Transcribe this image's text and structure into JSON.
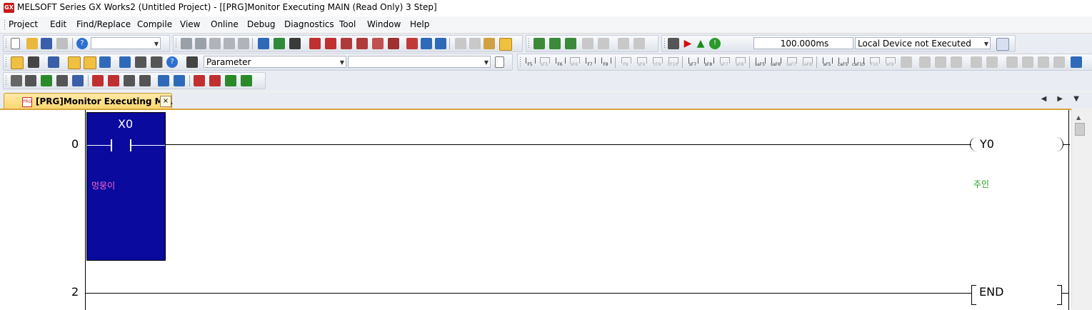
{
  "app": {
    "icon_label": "GX",
    "title": "MELSOFT Series GX Works2 (Untitled Project) - [[PRG]Monitor Executing MAIN (Read Only) 3 Step]"
  },
  "menu": [
    "Project",
    "Edit",
    "Find/Replace",
    "Compile",
    "View",
    "Online",
    "Debug",
    "Diagnostics",
    "Tool",
    "Window",
    "Help"
  ],
  "toolbar": {
    "monitor_interval": "100.000ms",
    "local_device_status": "Local Device not Executed",
    "parameter_dropdown": "Parameter",
    "blank_dropdown": ""
  },
  "tab": {
    "icon_label": "PRG",
    "label": "[PRG]Monitor Executing M...",
    "close": "×",
    "nav": "◀ ▶ ▼"
  },
  "ladder": {
    "colors": {
      "contact_on_highlight": "#0a0a9e",
      "comment_pink": "#ff66cc",
      "comment_green": "#1a9e1a",
      "rail": "#000000"
    },
    "rungs": [
      {
        "step": "0",
        "contact": {
          "device": "X0",
          "comment": "멍뭉이",
          "state": "ON"
        },
        "coil": {
          "device": "Y0",
          "comment": "주인"
        }
      },
      {
        "step": "2",
        "instruction": "END"
      }
    ]
  }
}
